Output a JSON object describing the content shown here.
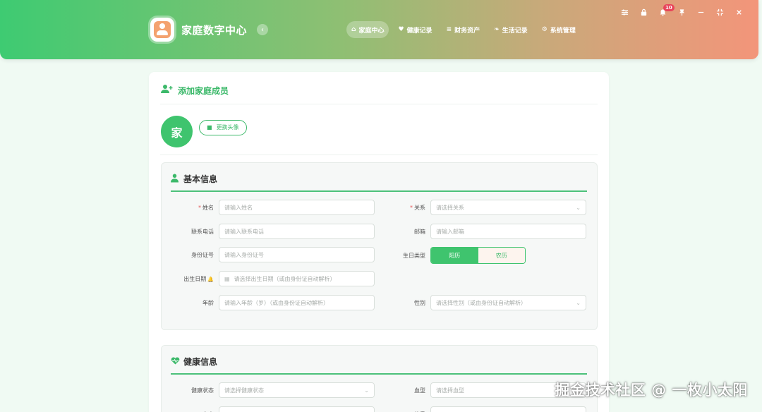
{
  "app": {
    "title": "家庭数字中心"
  },
  "header": {
    "nav": [
      {
        "label": "家庭中心",
        "icon": "home-icon",
        "active": true
      },
      {
        "label": "健康记录",
        "icon": "heart-pulse-icon",
        "active": false
      },
      {
        "label": "财务资产",
        "icon": "coins-icon",
        "active": false
      },
      {
        "label": "生活记录",
        "icon": "leaf-icon",
        "active": false
      },
      {
        "label": "系统管理",
        "icon": "gears-icon",
        "active": false
      }
    ],
    "notification_count": "10",
    "colors": {
      "gradient_start": "#3ecb72",
      "gradient_end": "#f3957a"
    }
  },
  "card": {
    "title": "添加家庭成员",
    "avatar_text": "家",
    "change_avatar": "更换头像"
  },
  "basic": {
    "title": "基本信息",
    "name": {
      "label": "姓名",
      "placeholder": "请输入姓名"
    },
    "relation": {
      "label": "关系",
      "placeholder": "请选择关系"
    },
    "phone": {
      "label": "联系电话",
      "placeholder": "请输入联系电话"
    },
    "email": {
      "label": "邮箱",
      "placeholder": "请输入邮箱"
    },
    "idcard": {
      "label": "身份证号",
      "placeholder": "请输入身份证号"
    },
    "birth_type": {
      "label": "生日类型",
      "options": [
        "阳历",
        "农历"
      ],
      "selected": "阳历"
    },
    "birthday": {
      "label": "出生日期",
      "placeholder": "请选择出生日期（或由身份证自动解析）"
    },
    "age": {
      "label": "年龄",
      "placeholder": "请输入年龄（岁）（或由身份证自动解析）"
    },
    "gender": {
      "label": "性别",
      "placeholder": "请选择性别（或由身份证自动解析）"
    }
  },
  "health": {
    "title": "健康信息",
    "status": {
      "label": "健康状态",
      "placeholder": "请选择健康状态"
    },
    "blood": {
      "label": "血型",
      "placeholder": "请选择血型"
    },
    "row3_left_label": "身高",
    "row3_right_label": "体重"
  },
  "watermark": "掘金技术社区 @ 一枚小太阳"
}
